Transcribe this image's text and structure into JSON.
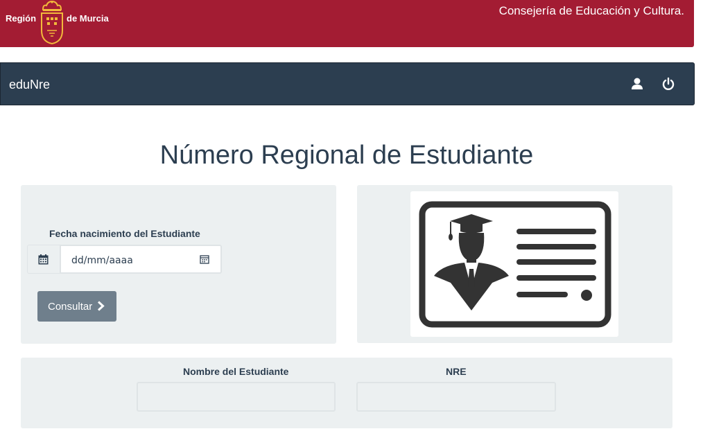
{
  "header": {
    "logo_left": "Región",
    "logo_right": "de Murcia",
    "consejeria": "Consejería de Educación y Cultura."
  },
  "navbar": {
    "brand": "eduNre",
    "icons": [
      "user-icon",
      "power-icon"
    ]
  },
  "page": {
    "title": "Número Regional de Estudiante"
  },
  "form": {
    "fecha_label": "Fecha nacimiento del Estudiante",
    "fecha_placeholder": "dd/mm/aaaa",
    "consultar_label": "Consultar"
  },
  "results": {
    "nombre_label": "Nombre del Estudiante",
    "nombre_value": "",
    "nre_label": "NRE",
    "nre_value": ""
  },
  "colors": {
    "banner": "#a31c33",
    "navbar": "#2c3e50",
    "panel": "#ecf0f1",
    "button": "#6f7f8c"
  }
}
